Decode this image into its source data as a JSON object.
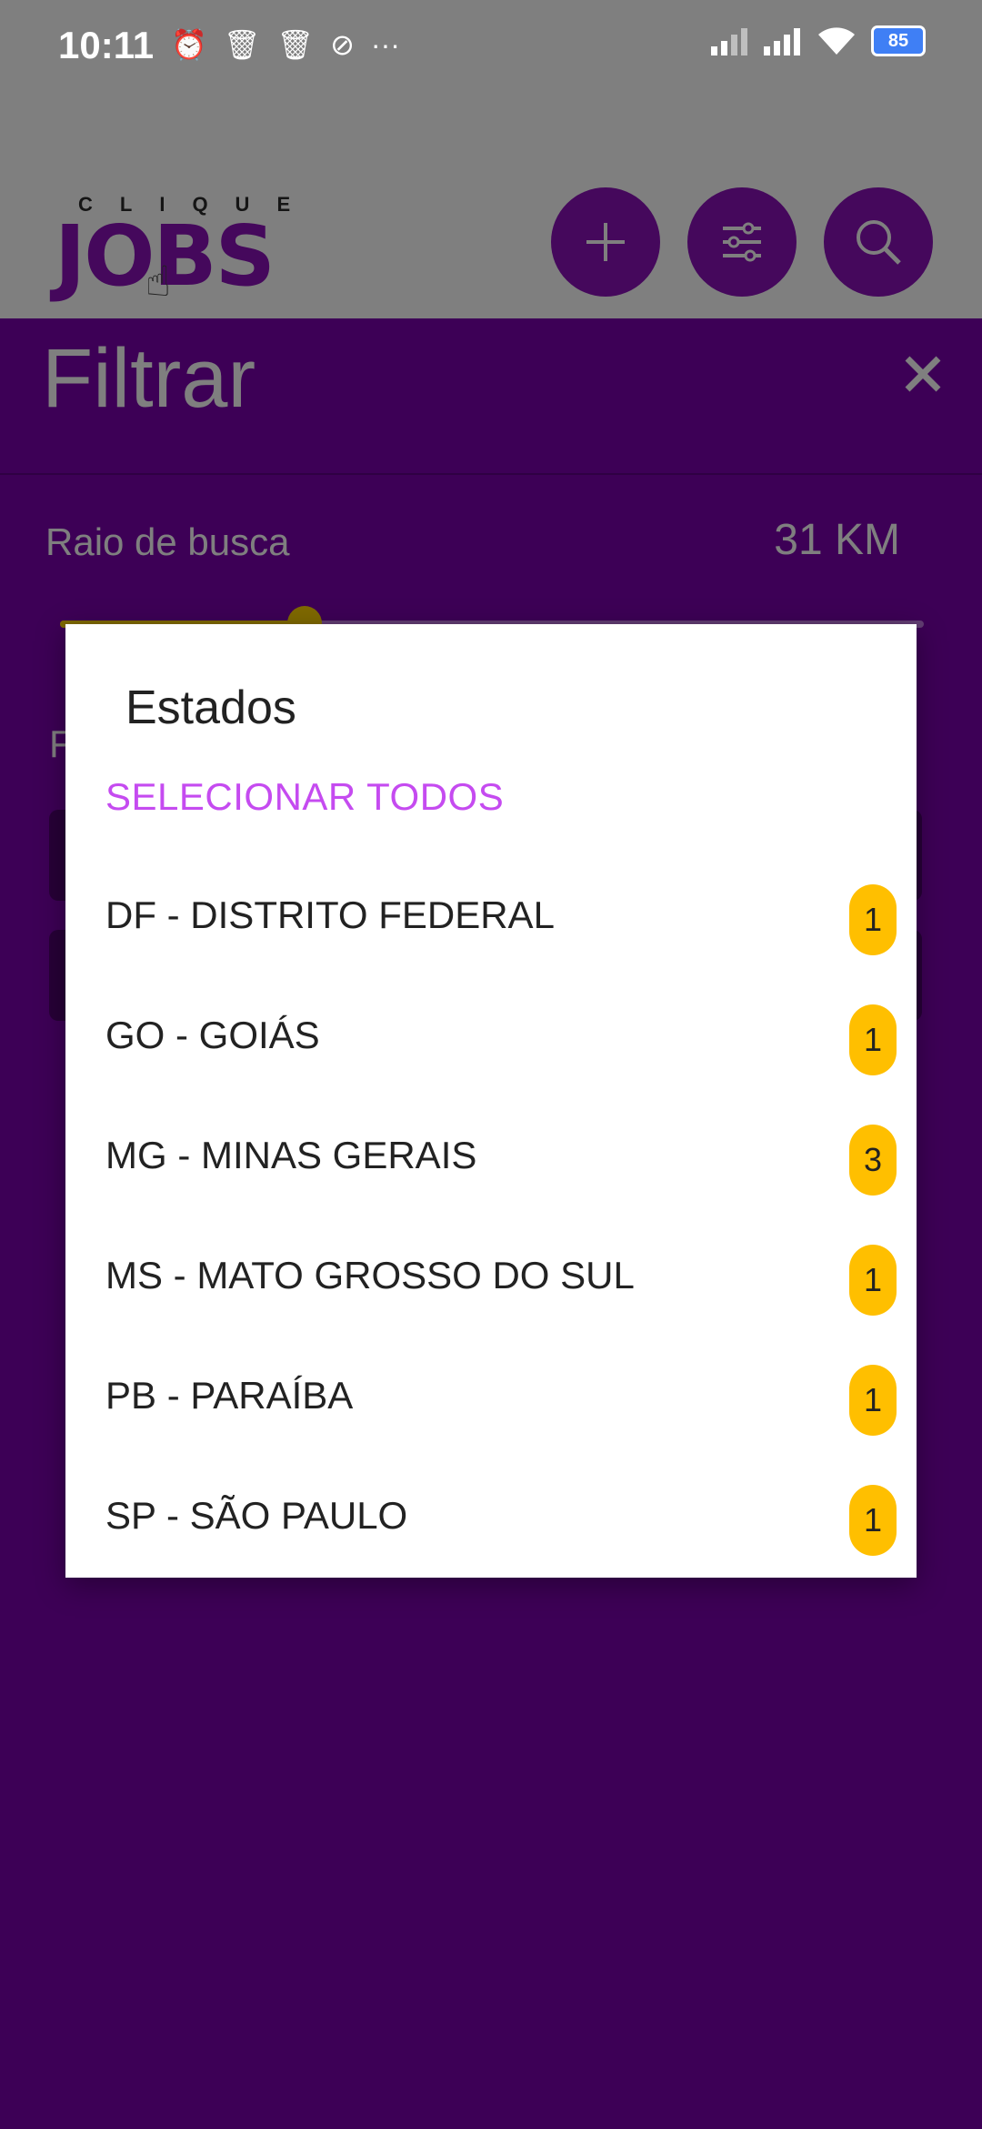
{
  "status_bar": {
    "time": "10:11",
    "left_icons": [
      "alarm-icon",
      "trash-icon",
      "trash-icon",
      "no-disturb-icon",
      "more-icon"
    ],
    "battery": "85"
  },
  "app": {
    "logo_small": "CLIQUE",
    "logo_big": "JOBS",
    "accent_color": "#8a11b8"
  },
  "filter_sheet": {
    "title": "Filtrar",
    "radius_label": "Raio de busca",
    "radius_value": "31 KM",
    "section_label": "F"
  },
  "dialog": {
    "title": "Estados",
    "select_all": "SELECIONAR TODOS",
    "options": [
      {
        "label": "DF - DISTRITO FEDERAL",
        "count": "1"
      },
      {
        "label": "GO - GOIÁS",
        "count": "1"
      },
      {
        "label": "MG - MINAS GERAIS",
        "count": "3"
      },
      {
        "label": "MS - MATO GROSSO DO SUL",
        "count": "1"
      },
      {
        "label": "PB - PARAÍBA",
        "count": "1"
      },
      {
        "label": "SP - SÃO PAULO",
        "count": "1"
      }
    ]
  }
}
